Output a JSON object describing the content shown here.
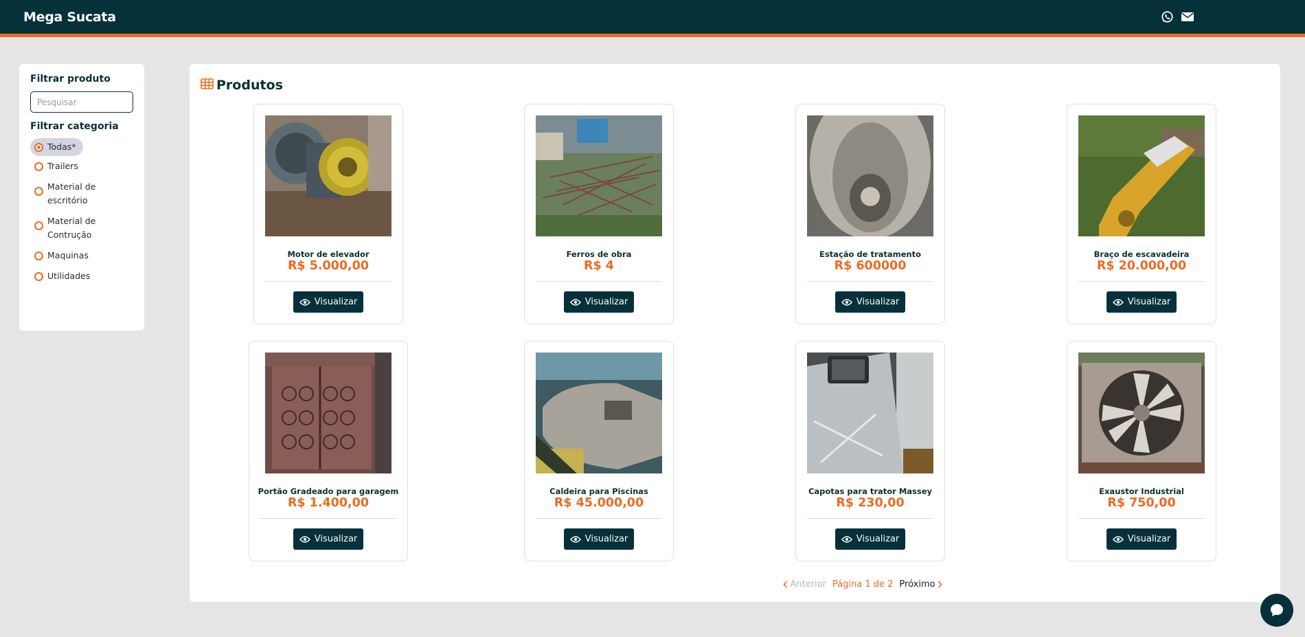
{
  "app": {
    "brand": "Mega Sucata"
  },
  "header": {
    "icons": [
      "whatsapp-icon",
      "mail-icon"
    ]
  },
  "sidebar": {
    "filter_product_title": "Filtrar produto",
    "search_placeholder": "Pesquisar",
    "filter_category_title": "Filtrar categoria",
    "categories": [
      {
        "label": "Todas*",
        "selected": true
      },
      {
        "label": "Trailers",
        "selected": false
      },
      {
        "label": "Material de escritório",
        "selected": false
      },
      {
        "label": "Material de Contrução",
        "selected": false
      },
      {
        "label": "Maquinas",
        "selected": false
      },
      {
        "label": "Utilidades",
        "selected": false
      }
    ]
  },
  "main": {
    "title": "Produtos",
    "view_button_label": "Visualizar",
    "products": [
      {
        "name": "Motor de elevador",
        "price": "R$ 5.000,00"
      },
      {
        "name": "Ferros de obra",
        "price": "R$ 4"
      },
      {
        "name": "Estação de tratamento",
        "price": "R$ 600000"
      },
      {
        "name": "Braço de escavadeira",
        "price": "R$ 20.000,00"
      },
      {
        "name": "Portão Gradeado para garagem",
        "price": "R$ 1.400,00"
      },
      {
        "name": "Caldeira para Piscinas",
        "price": "R$ 45.000,00"
      },
      {
        "name": "Capotas para trator Massey",
        "price": "R$ 230,00"
      },
      {
        "name": "Exaustor Industrial",
        "price": "R$ 750,00"
      }
    ]
  },
  "pagination": {
    "prev": "Anterior",
    "info": "Página 1 de 2",
    "next": "Próximo",
    "current_page": 1,
    "total_pages": 2
  },
  "colors": {
    "primary": "#06303a",
    "accent": "#ec6b21",
    "background": "#e5e5e5"
  }
}
